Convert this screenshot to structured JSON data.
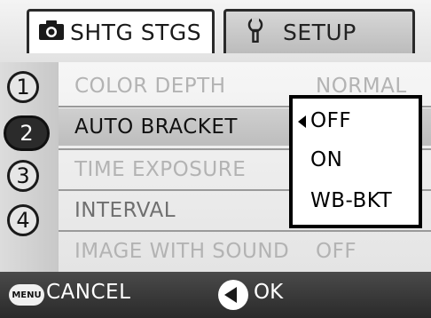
{
  "tabs": [
    {
      "label": "SHTG STGS",
      "icon": "camera-icon",
      "active": true
    },
    {
      "label": "SETUP",
      "icon": "wrench-icon",
      "active": false
    }
  ],
  "rail": [
    "1",
    "2",
    "3",
    "4"
  ],
  "menu": [
    {
      "label": "COLOR DEPTH",
      "value": "NORMAL"
    },
    {
      "label": "AUTO BRACKET",
      "value": ""
    },
    {
      "label": "TIME EXPOSURE",
      "value": ""
    },
    {
      "label": "INTERVAL",
      "value": ""
    },
    {
      "label": "IMAGE WITH SOUND",
      "value": "OFF"
    }
  ],
  "dropdown": {
    "options": [
      "OFF",
      "ON",
      "WB-BKT"
    ],
    "selected": "OFF"
  },
  "bottom": {
    "menu_icon_label": "MENU",
    "cancel": "CANCEL",
    "ok": "OK"
  }
}
